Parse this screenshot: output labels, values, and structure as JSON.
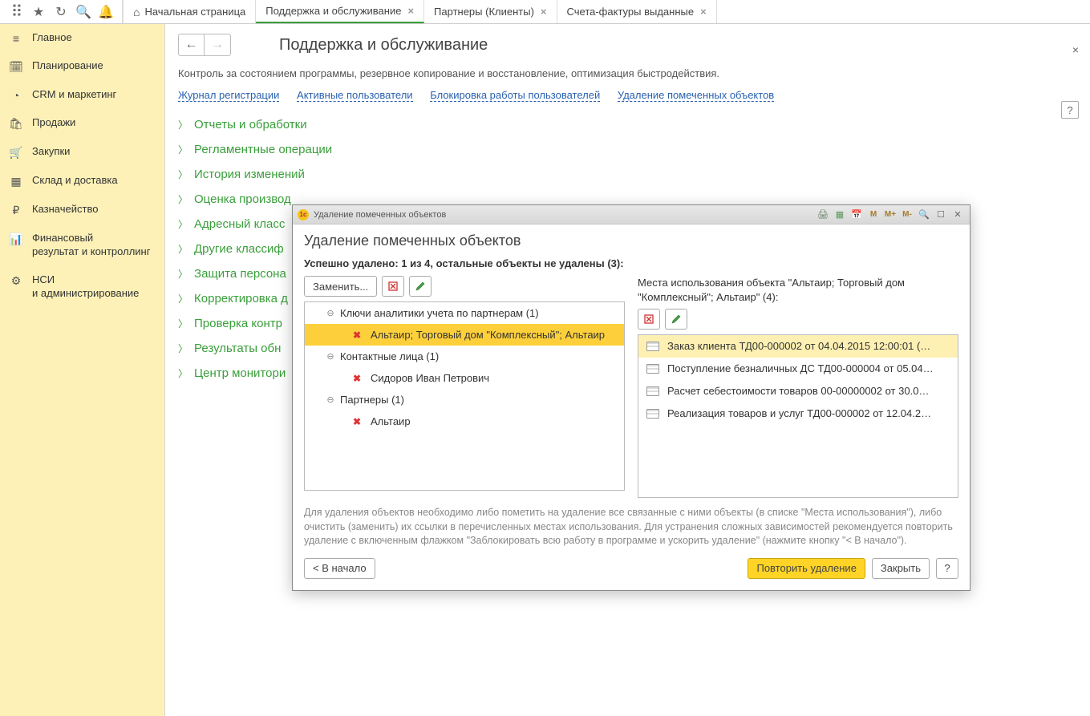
{
  "tabs": {
    "home": "Начальная страница",
    "t1": "Поддержка и обслуживание",
    "t2": "Партнеры (Клиенты)",
    "t3": "Счета-фактуры выданные"
  },
  "sidebar": {
    "items": [
      {
        "label": "Главное"
      },
      {
        "label": "Планирование"
      },
      {
        "label": "CRM и маркетинг"
      },
      {
        "label": "Продажи"
      },
      {
        "label": "Закупки"
      },
      {
        "label": "Склад и доставка"
      },
      {
        "label": "Казначейство"
      },
      {
        "label": "Финансовый\nрезультат и контроллинг"
      },
      {
        "label": "НСИ\nи администрирование"
      }
    ]
  },
  "page": {
    "title": "Поддержка и обслуживание",
    "desc": "Контроль за состоянием программы, резервное копирование и восстановление, оптимизация быстродействия.",
    "links": {
      "l1": "Журнал регистрации",
      "l2": "Активные пользователи",
      "l3": "Блокировка работы пользователей",
      "l4": "Удаление помеченных объектов"
    },
    "sections": [
      {
        "label": "Отчеты и обработки"
      },
      {
        "label": "Регламентные операции"
      },
      {
        "label": "История изменений"
      },
      {
        "label": "Оценка производ"
      },
      {
        "label": "Адресный класс"
      },
      {
        "label": "Другие классиф"
      },
      {
        "label": "Защита персона"
      },
      {
        "label": "Корректировка д"
      },
      {
        "label": "Проверка контр"
      },
      {
        "label": "Результаты обн"
      },
      {
        "label": "Центр монитори"
      }
    ]
  },
  "dialog": {
    "titlebar": "Удаление помеченных объектов",
    "heading": "Удаление помеченных объектов",
    "status_pre": "Успешно удалено: ",
    "status_bold": "1 из 4",
    "status_post": ", остальные объекты не удалены (3):",
    "replace_btn": "Заменить...",
    "left_tree": {
      "g1": "Ключи аналитики учета по партнерам (1)",
      "g1_i1": "Альтаир; Торговый дом \"Комплексный\"; Альтаир",
      "g2": "Контактные лица  (1)",
      "g2_i1": "Сидоров Иван Петрович",
      "g3": "Партнеры  (1)",
      "g3_i1": "Альтаир"
    },
    "right_head": "Места использования объекта \"Альтаир; Торговый дом \"Комплексный\"; Альтаир\" (4):",
    "usages": [
      "Заказ клиента ТД00-000002 от 04.04.2015 12:00:01 (…",
      "Поступление безналичных ДС ТД00-000004 от 05.04…",
      "Расчет себестоимости товаров 00-00000002 от 30.0…",
      "Реализация товаров и услуг ТД00-000002 от 12.04.2…"
    ],
    "hint": "Для удаления объектов необходимо либо пометить на удаление все связанные с ними объекты (в списке \"Места использования\"), либо очистить (заменить) их ссылки в перечисленных местах использования. Для устранения сложных зависимостей рекомендуется повторить удаление с включенным флажком \"Заблокировать всю работу в программе и ускорить удаление\" (нажмите кнопку \"< В начало\").",
    "btn_back": "< В начало",
    "btn_repeat": "Повторить удаление",
    "btn_close": "Закрыть",
    "btn_help": "?"
  },
  "help_label": "?"
}
